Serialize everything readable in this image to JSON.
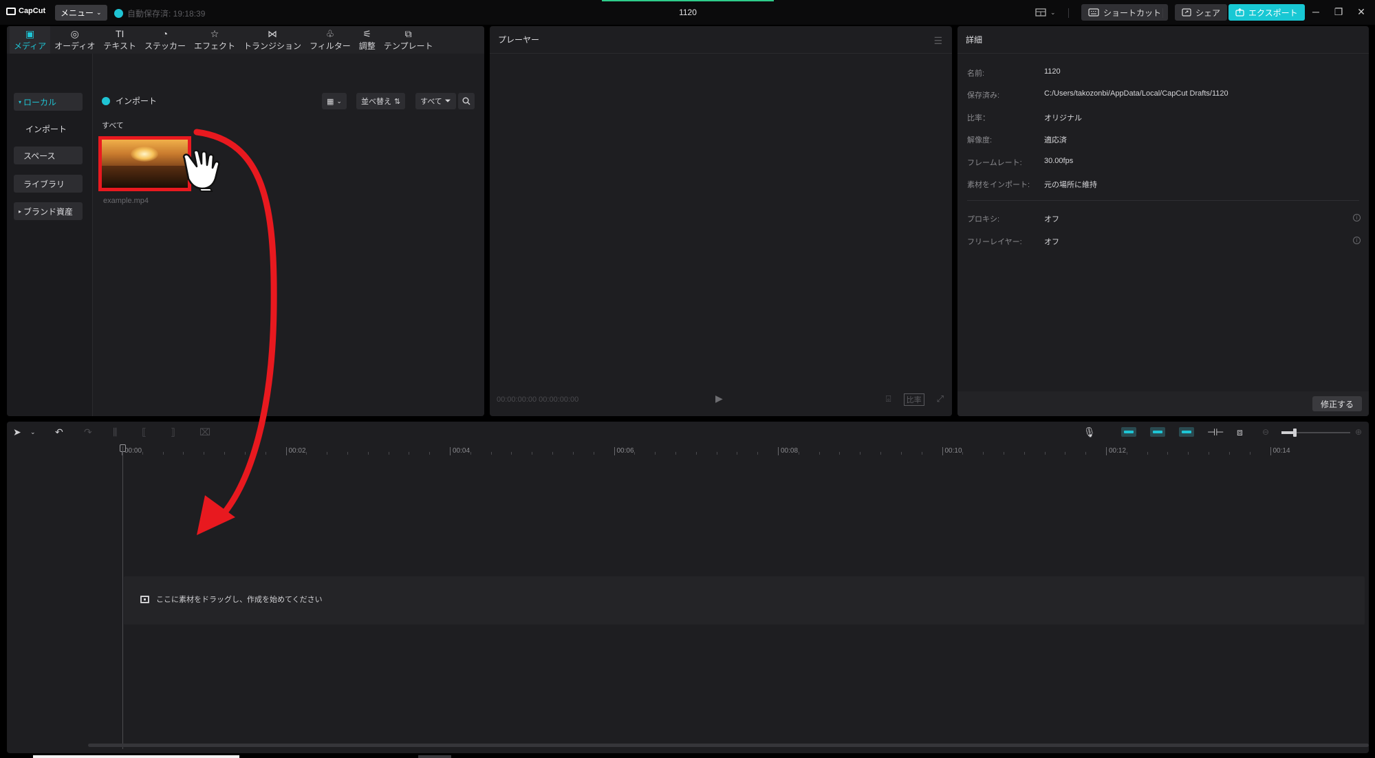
{
  "app": {
    "logo_text": "CapCut",
    "menu_label": "メニュー",
    "autosave_text": "自動保存済: 19:18:39",
    "project_title": "1120",
    "shortcut_label": "ショートカット",
    "share_label": "シェア",
    "export_label": "エクスポート",
    "accent_color": "#1fc4d4"
  },
  "media_tabs": [
    {
      "label": "メディア",
      "icon": "media-icon",
      "active": true
    },
    {
      "label": "オーディオ",
      "icon": "audio-icon"
    },
    {
      "label": "テキスト",
      "icon": "text-icon"
    },
    {
      "label": "ステッカー",
      "icon": "sticker-icon"
    },
    {
      "label": "エフェクト",
      "icon": "effect-icon"
    },
    {
      "label": "トランジション",
      "icon": "transition-icon"
    },
    {
      "label": "フィルター",
      "icon": "filter-icon"
    },
    {
      "label": "調整",
      "icon": "adjust-icon"
    },
    {
      "label": "テンプレート",
      "icon": "template-icon"
    }
  ],
  "media_sidebar": {
    "local": "ローカル",
    "import": "インポート",
    "space": "スペース",
    "library": "ライブラリ",
    "brand": "ブランド資産"
  },
  "media_main": {
    "import_label": "インポート",
    "sort_label": "並べ替え",
    "filter_label": "すべて",
    "all_label": "すべて",
    "file_name": "example.mp4"
  },
  "player": {
    "title": "プレーヤー",
    "timecode": "00:00:00:00  00:00:00:00",
    "ratio_label": "比率"
  },
  "details": {
    "title": "詳細",
    "rows": [
      {
        "key": "名前:",
        "value": "1120"
      },
      {
        "key": "保存済み:",
        "value": "C:/Users/takozonbi/AppData/Local/CapCut Drafts/1120"
      },
      {
        "key": "比率：",
        "value": "オリジナル"
      },
      {
        "key": "解像度:",
        "value": "適応済"
      },
      {
        "key": "フレームレート:",
        "value": "30.00fps"
      },
      {
        "key": "素材をインポート:",
        "value": "元の場所に維持"
      }
    ],
    "rows2": [
      {
        "key": "プロキシ:",
        "value": "オフ"
      },
      {
        "key": "フリーレイヤー:",
        "value": "オフ"
      }
    ],
    "fix_button": "修正する"
  },
  "timeline": {
    "ticks": [
      "00:00",
      "00:02",
      "00:04",
      "00:06",
      "00:08",
      "00:10",
      "00:12",
      "00:14"
    ],
    "drop_hint": "ここに素材をドラッグし、作成を始めてください"
  }
}
